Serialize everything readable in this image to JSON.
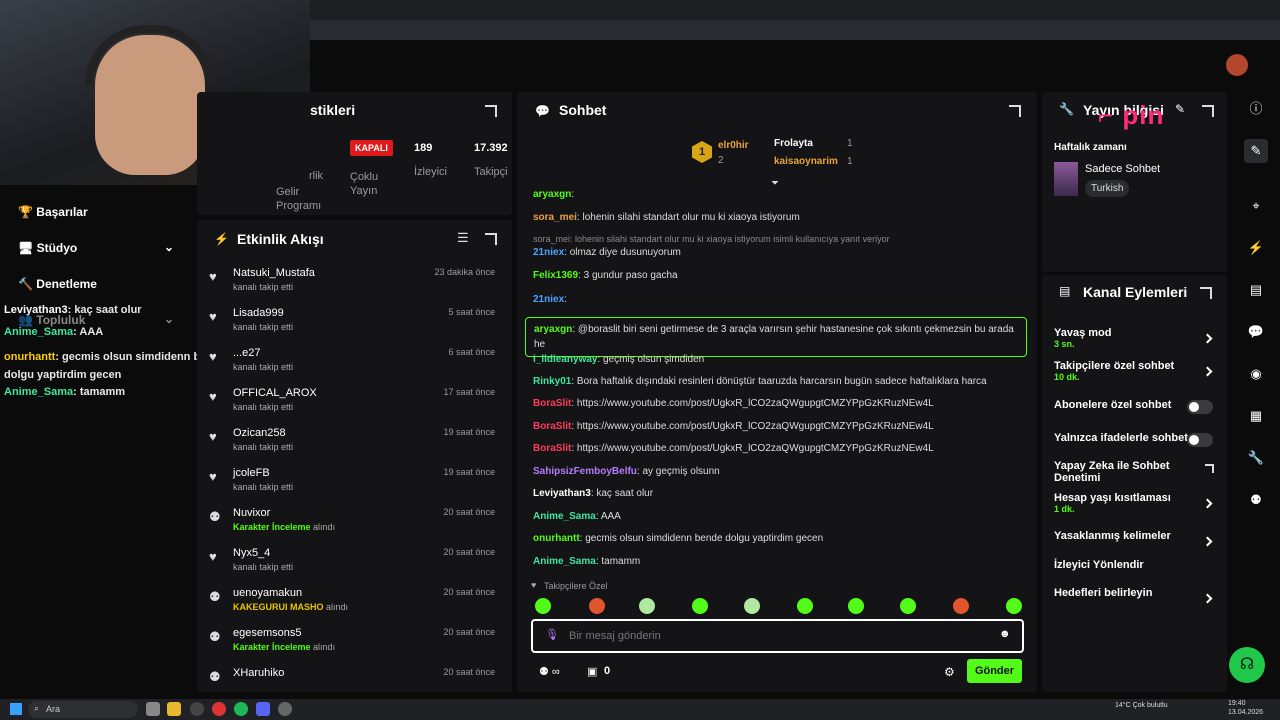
{
  "stats": {
    "title_partial": "stikleri",
    "items": [
      {
        "value": "KAPALI",
        "label": "Çoklu Yayın"
      },
      {
        "value": "189",
        "label": "İzleyici"
      },
      {
        "value": "17.392",
        "label": "Takipçi"
      }
    ],
    "cut_label_1": "rlik",
    "cut_label_2": "Gelir Programı"
  },
  "left_nav": [
    {
      "label": "Başarılar"
    },
    {
      "label": "Stüdyo"
    },
    {
      "label": "Denetleme"
    },
    {
      "label": "Topluluk"
    }
  ],
  "overlay_chat": [
    {
      "user": "Leviyathan3",
      "text": ": kaç saat olur",
      "color": "#ffffff"
    },
    {
      "user": "Anime_Sama",
      "text": ": AAA",
      "color": "#3ee6a0"
    },
    {
      "user": "onurhantt",
      "text": ": gecmis olsun simdidenn bende dolgu yaptirdim gecen",
      "color": "#ffcc00"
    },
    {
      "user": "Anime_Sama",
      "text": ": tamamm",
      "color": "#3ee6a0"
    }
  ],
  "activity": {
    "title": "Etkinlik Akışı",
    "items": [
      {
        "name": "Natsuki_Mustafa",
        "sub": "kanalı takip etti",
        "time": "23 dakika önce",
        "icon": "heart-icon"
      },
      {
        "name": "Lisada999",
        "sub": "kanalı takip etti",
        "time": "5 saat önce",
        "icon": "heart-icon"
      },
      {
        "name": "...e27",
        "sub": "kanalı takip etti",
        "time": "6 saat önce",
        "icon": "heart-icon"
      },
      {
        "name": "OFFICAL_AROX",
        "sub": "kanalı takip etti",
        "time": "17 saat önce",
        "icon": "heart-icon"
      },
      {
        "name": "Ozican258",
        "sub": "kanalı takip etti",
        "time": "19 saat önce",
        "icon": "heart-icon"
      },
      {
        "name": "jcoleFB",
        "sub": "kanalı takip etti",
        "time": "19 saat önce",
        "icon": "heart-icon"
      },
      {
        "name": "Nuvixor",
        "sub_green": "Karakter İnceleme",
        "sub": " alındı",
        "time": "20 saat önce",
        "icon": "reward-icon"
      },
      {
        "name": "Nyx5_4",
        "sub": "kanalı takip etti",
        "time": "20 saat önce",
        "icon": "heart-icon"
      },
      {
        "name": "uenoyamakun",
        "sub_yellow": "KAKEGURUI MASHO",
        "sub": " alındı",
        "time": "20 saat önce",
        "icon": "reward-icon"
      },
      {
        "name": "egesemsons5",
        "sub_green": "Karakter İnceleme",
        "sub": " alındı",
        "time": "20 saat önce",
        "icon": "reward-icon"
      },
      {
        "name": "XHaruhiko",
        "sub": "",
        "time": "20 saat önce",
        "icon": "reward-icon"
      }
    ]
  },
  "chat": {
    "title": "Sohbet",
    "leaderboard": [
      {
        "rank": "1",
        "name": "elr0hir",
        "count": "2"
      },
      {
        "name": "Frolayta",
        "count": "1"
      },
      {
        "name": "kaisaoynarim",
        "count": "1"
      }
    ],
    "messages": [
      {
        "user": "aryaxgn",
        "text": ":",
        "color": "#53fc18"
      },
      {
        "user": "sora_mei",
        "text": ": lohenin silahi standart olur mu ki xiaoya istiyorum",
        "color": "#e8a33d"
      },
      {
        "reply": "sora_mei: lohenin silahi standart olur mu ki xiaoya istiyorum isimli kullanıcıya yanıt veriyor"
      },
      {
        "user": "21niex",
        "text": ": olmaz diye dusunuyorum",
        "color": "#4aa3ff"
      },
      {
        "user": "Felix1369",
        "text": ": 3 gundur paso gacha",
        "color": "#53fc18"
      },
      {
        "user": "21niex",
        "text": ":",
        "color": "#4aa3ff"
      },
      {
        "user": "aryaxgn",
        "text": ": @boraslit biri seni getirmese de 3 araçla varırsın şehir hastanesine çok sıkıntı çekmezsin bu arada he",
        "color": "#53fc18"
      },
      {
        "user": "i_lldieanyway",
        "text": ": geçmiş olsun şimdiden",
        "color": "#3ee6a0"
      },
      {
        "user": "Rinky01",
        "text": ": Bora haftalık dışındaki resinleri dönüştür taaruzda harcarsın bugün sadece haftalıklara harca",
        "color": "#3ee6a0"
      },
      {
        "user": "BoraSlit",
        "text": ": https://www.youtube.com/post/UgkxR_lCO2zaQWgupgtCMZYPpGzKRuzNEw4L",
        "color": "#ff3b5c"
      },
      {
        "user": "BoraSlit",
        "text": ": https://www.youtube.com/post/UgkxR_lCO2zaQWgupgtCMZYPpGzKRuzNEw4L",
        "color": "#ff3b5c"
      },
      {
        "user": "BoraSlit",
        "text": ": https://www.youtube.com/post/UgkxR_lCO2zaQWgupgtCMZYPpGzKRuzNEw4L",
        "color": "#ff3b5c"
      },
      {
        "user": "SahipsizFemboyBelfu",
        "text": ": ay geçmiş olsunn",
        "color": "#b57bff"
      },
      {
        "user": "Leviyathan3",
        "text": ": kaç saat olur",
        "color": "#ffffff"
      },
      {
        "user": "Anime_Sama",
        "text": ": AAA",
        "color": "#3ee6a0"
      },
      {
        "user": "onurhantt",
        "text": ": gecmis olsun simdidenn bende dolgu yaptirdim gecen",
        "color": "#53fc18"
      },
      {
        "user": "Anime_Sama",
        "text": ": tamamm",
        "color": "#3ee6a0"
      }
    ],
    "followers_only": "Takipçilere Özel",
    "input_placeholder": "Bir mesaj gönderin",
    "send_label": "Gönder",
    "points_count": "0"
  },
  "stream_info": {
    "title": "Yayın bilgisi",
    "time_label": "Haftalık zamanı",
    "category": "Sadece Sohbet",
    "tag": "Turkish"
  },
  "channel_actions": {
    "title": "Kanal Eylemleri",
    "rows": [
      {
        "label": "Yavaş mod",
        "sub": "3 sn.",
        "control": "chevron"
      },
      {
        "label": "Takipçilere özel sohbet",
        "sub": "10 dk.",
        "control": "chevron"
      },
      {
        "label": "Abonelere özel sohbet",
        "sub": "",
        "control": "toggle"
      },
      {
        "label": "Yalnızca ifadelerle sohbet",
        "sub": "",
        "control": "toggle"
      },
      {
        "label": "Yapay Zeka ile Sohbet Denetimi",
        "sub": "",
        "control": "external"
      },
      {
        "label": "Hesap yaşı kısıtlaması",
        "sub": "1 dk.",
        "control": "chevron"
      },
      {
        "label": "Yasaklanmış kelimeler",
        "sub": "",
        "control": "chevron"
      },
      {
        "label": "İzleyici Yönlendir",
        "sub": "",
        "control": "none"
      },
      {
        "label": "Hedefleri belirleyin",
        "sub": "",
        "control": "chevron"
      }
    ]
  },
  "taskbar": {
    "search": "Ara",
    "weather": "14°C Çok bulutlu",
    "time": "19:40",
    "date": "13.04.2026"
  },
  "colors": {
    "accent": "#53fc18",
    "panel": "#141416",
    "bg": "#0b0b0c"
  }
}
